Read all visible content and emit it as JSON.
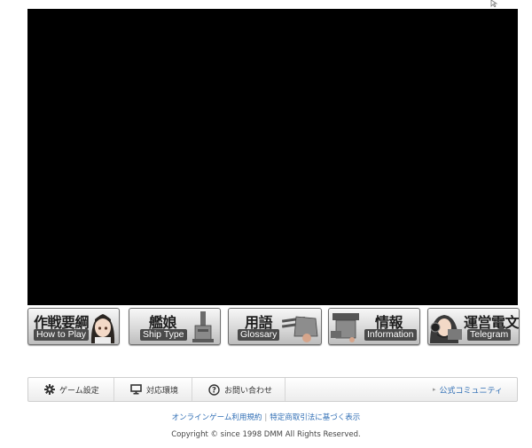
{
  "banners": [
    {
      "jp": "作戦要綱",
      "en": "How to Play",
      "icon": "girl-portrait-icon"
    },
    {
      "jp": "艦娘",
      "en": "Ship Type",
      "icon": "ship-gun-icon"
    },
    {
      "jp": "用語",
      "en": "Glossary",
      "icon": "cannon-icon"
    },
    {
      "jp": "情報",
      "en": "Information",
      "icon": "rigging-icon"
    },
    {
      "jp": "運営電文",
      "en": "Telegram",
      "icon": "headset-girl-icon"
    }
  ],
  "toolbar": {
    "game_settings": "ゲーム設定",
    "environment": "対応環境",
    "contact": "お問い合わせ",
    "community": "公式コミュニティ"
  },
  "footer": {
    "terms": "オンラインゲーム利用規約",
    "commerce_law": "特定商取引法に基づく表示",
    "copyright": "Copyright © since 1998 DMM All Rights Reserved."
  }
}
